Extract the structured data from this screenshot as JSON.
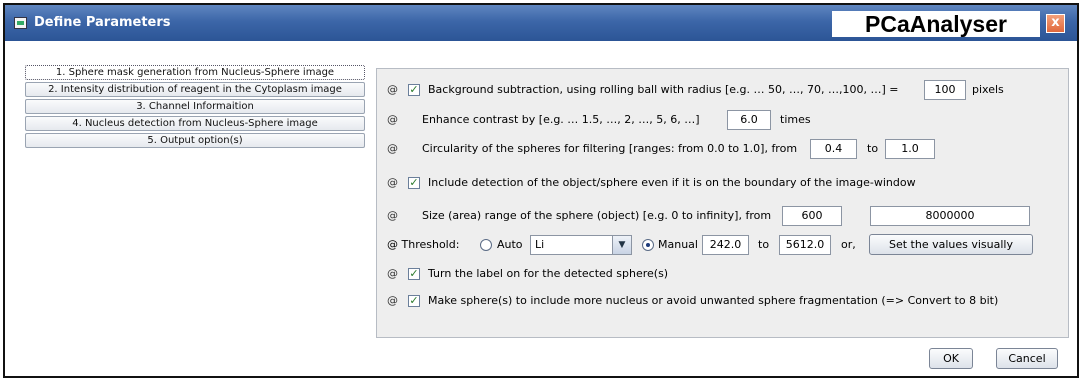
{
  "window": {
    "title": "Define Parameters",
    "brand": "PCaAnalyser",
    "close_label": "x"
  },
  "tabs": [
    {
      "label": "1. Sphere mask generation from Nucleus-Sphere image",
      "active": true
    },
    {
      "label": "2. Intensity distribution of reagent in the Cytoplasm image",
      "active": false
    },
    {
      "label": "3. Channel Informaition",
      "active": false
    },
    {
      "label": "4. Nucleus detection from Nucleus-Sphere image",
      "active": false
    },
    {
      "label": "5. Output option(s)",
      "active": false
    }
  ],
  "params": {
    "at_symbol": "@",
    "check_mark": "✓",
    "background": {
      "checked": true,
      "label": "Background subtraction, using rolling ball with radius [e.g. … 50, …, 70, …,100, …] =",
      "value": "100",
      "unit": "pixels"
    },
    "contrast": {
      "label": "Enhance contrast by [e.g. … 1.5, …, 2, …, 5, 6, …]",
      "value": "6.0",
      "unit": "times"
    },
    "circularity": {
      "label": "Circularity of the spheres for filtering [ranges: from 0.0 to 1.0], from",
      "from": "0.4",
      "to_label": "to",
      "to": "1.0"
    },
    "boundary": {
      "checked": true,
      "label": "Include detection of the object/sphere even if it is on the boundary of the image-window"
    },
    "size": {
      "label": "Size (area) range of the sphere (object) [e.g. 0 to infinity], from",
      "from": "600",
      "to_label": "to",
      "to": "8000000"
    },
    "threshold": {
      "label": "Threshold:",
      "auto_label": "Auto",
      "auto_selected": false,
      "method": "Li",
      "manual_label": "Manual",
      "manual_selected": true,
      "min": "242.0",
      "to_label": "to",
      "max": "5612.0",
      "or_label": "or,",
      "visual_button": "Set the values visually"
    },
    "label_on": {
      "checked": true,
      "label": "Turn the label on for the detected sphere(s)"
    },
    "convert": {
      "checked": true,
      "label": "Make sphere(s) to include more nucleus or avoid unwanted sphere fragmentation (=> Convert to 8 bit)"
    }
  },
  "buttons": {
    "ok": "OK",
    "cancel": "Cancel"
  }
}
